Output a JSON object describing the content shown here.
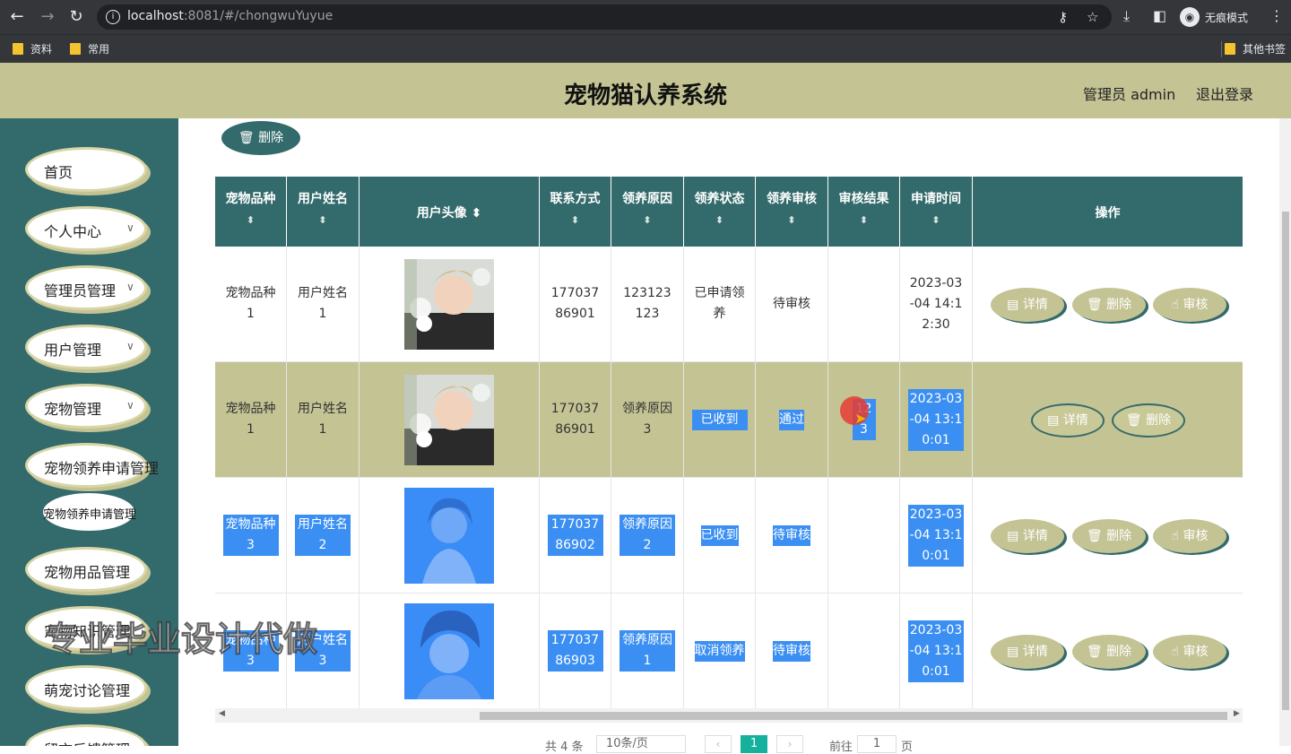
{
  "browser": {
    "url_host": "localhost",
    "url_port": ":8081",
    "url_path": "/#/chongwuYuyue",
    "incognito_label": "无痕模式",
    "bookmarks": [
      "资料",
      "常用"
    ],
    "other_bookmarks": "其他书签"
  },
  "header": {
    "title": "宠物猫认养系统",
    "user": "管理员 admin",
    "logout": "退出登录"
  },
  "sidebar": {
    "items": [
      {
        "label": "首页"
      },
      {
        "label": "个人中心"
      },
      {
        "label": "管理员管理"
      },
      {
        "label": "用户管理"
      },
      {
        "label": "宠物管理"
      },
      {
        "label": "宠物领养申请管理"
      },
      {
        "label": "宠物领养申请管理"
      },
      {
        "label": "宠物用品管理"
      },
      {
        "label": "宠物知识管理"
      },
      {
        "label": "萌宠讨论管理"
      },
      {
        "label": "留言反馈管理"
      }
    ]
  },
  "toolbar": {
    "delete_label": "删除"
  },
  "table": {
    "headers": [
      "宠物品种",
      "用户姓名",
      "用户头像",
      "联系方式",
      "领养原因",
      "领养状态",
      "领养审核",
      "审核结果",
      "申请时间",
      "操作"
    ],
    "sort_icon": "⬍",
    "rows": [
      {
        "breed": "宠物品种1",
        "name": "用户姓名1",
        "phone": "17703786901",
        "reason": "123123123",
        "status": "已申请领养",
        "review": "待审核",
        "result": "",
        "time": "2023-03-04 14:12:30",
        "avatar": "photo-boy-flowers"
      },
      {
        "breed": "宠物品种1",
        "name": "用户姓名1",
        "phone": "17703786901",
        "reason": "领养原因3",
        "status": "已收到",
        "review": "通过",
        "result": "123",
        "time": "2023-03-04 13:10:01",
        "avatar": "photo-boy-flowers"
      },
      {
        "breed": "宠物品种3",
        "name": "用户姓名2",
        "phone": "17703786902",
        "reason": "领养原因2",
        "status": "已收到",
        "review": "待审核",
        "result": "",
        "time": "2023-03-04 13:10:01",
        "avatar": "photo-girl"
      },
      {
        "breed": "宠物品种3",
        "name": "用户姓名3",
        "phone": "17703786903",
        "reason": "领养原因1",
        "status": "取消领养",
        "review": "待审核",
        "result": "",
        "time": "2023-03-04 13:10:01",
        "avatar": "photo-anime"
      }
    ],
    "op": {
      "detail": "详情",
      "delete": "删除",
      "audit": "审核"
    }
  },
  "pagination": {
    "total": "共 4 条",
    "page_size": "10条/页",
    "current": "1",
    "goto": "前往",
    "goto_value": "1",
    "page_unit": "页"
  },
  "watermark": "专业毕业设计代做",
  "colors": {
    "header_bg": "#c4c394",
    "sidebar_bg": "#336a6b",
    "accent_teal": "#336a6b",
    "active_page": "#16b19c",
    "selection": "#3b8ff2"
  }
}
